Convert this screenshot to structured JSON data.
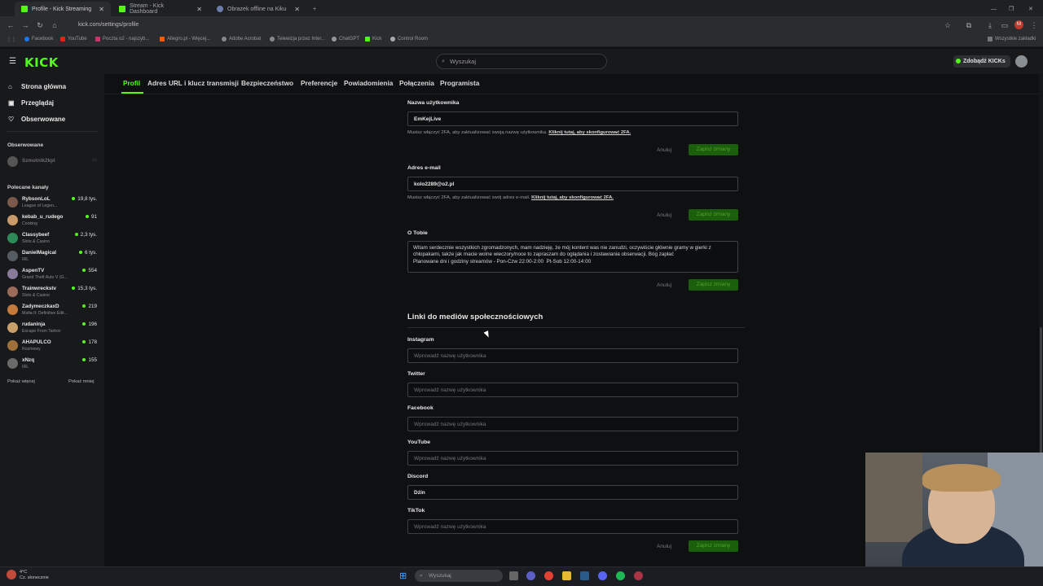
{
  "browser": {
    "tabs": [
      {
        "label": "Profile - Kick Streaming"
      },
      {
        "label": "Stream - Kick Dashboard"
      },
      {
        "label": "Obrazek offline na Kiku"
      }
    ],
    "url": "kick.com/settings/profile",
    "bookmarks": [
      "Facebook",
      "YouTube",
      "Poczta o2 - najszyb...",
      "Allegro.pl - Więcej...",
      "Adobe Acrobat",
      "Telewizja przez Inter...",
      "ChatGPT",
      "Kick",
      "Control Room"
    ],
    "bookmarks_right": "Wszystkie zakładki"
  },
  "header": {
    "logo": "KICK",
    "search_placeholder": "Wyszukaj",
    "kicks_button": "Zdobądź KICKs"
  },
  "sidebar": {
    "nav": [
      {
        "label": "Strona główna",
        "icon": "home-icon"
      },
      {
        "label": "Przeglądaj",
        "icon": "browse-icon"
      },
      {
        "label": "Obserwowane",
        "icon": "heart-icon"
      }
    ],
    "followed_title": "Obserwowane",
    "followed": [
      {
        "name": "Szmotnik2kpl"
      }
    ],
    "recommended_title": "Polecane kanały",
    "channels": [
      {
        "name": "RybsonLoL",
        "category": "League of Legen...",
        "viewers": "19,8 tys.",
        "color": "#7a5a4a"
      },
      {
        "name": "kebab_u_rudego",
        "category": "Cooking",
        "viewers": "91",
        "color": "#c99a6a"
      },
      {
        "name": "Classybeef",
        "category": "Slots & Casino",
        "viewers": "2,3 tys.",
        "color": "#2e8b57"
      },
      {
        "name": "DanielMagical",
        "category": "IRL",
        "viewers": "6 tys.",
        "color": "#555b63"
      },
      {
        "name": "AspenTV",
        "category": "Grand Theft Auto V (G...",
        "viewers": "554",
        "color": "#8a7a9a"
      },
      {
        "name": "Trainwreckstv",
        "category": "Slots & Casino",
        "viewers": "15,3 tys.",
        "color": "#9a6a5a"
      },
      {
        "name": "ZadymeczkaxD",
        "category": "Mafia II: Definitive Edit...",
        "viewers": "219",
        "color": "#c47a3a"
      },
      {
        "name": "rudaninja",
        "category": "Escape From Tarkov",
        "viewers": "196",
        "color": "#c9a06a"
      },
      {
        "name": "AHAPULCO",
        "category": "Rozmowy",
        "viewers": "178",
        "color": "#a0703a"
      },
      {
        "name": "xNzq",
        "category": "IRL",
        "viewers": "155",
        "color": "#6a6a6a"
      }
    ],
    "show_more": "Pokaż więcej",
    "show_less": "Pokaż mniej"
  },
  "settings_tabs": [
    "Profil",
    "Adres URL i klucz transmisji",
    "Bezpieczeństwo",
    "Preferencje",
    "Powiadomienia",
    "Połączenia",
    "Programista"
  ],
  "form": {
    "username_label": "Nazwa użytkownika",
    "username_value": "EmKejLive",
    "username_note": "Musisz włączyć 2FA, aby zaktualizować swoją nazwę użytkownika.",
    "twofa_link": "Kliknij tutaj, aby skonfigurować 2FA.",
    "email_label": "Adres e-mail",
    "email_value": "kolo2289@o2.pl",
    "email_note": "Musisz włączyć 2FA, aby zaktualizować swój adres e-mail.",
    "about_label": "O Tobie",
    "about_value": "Witam serdecznie wszystkich zgromadzonych, mam nadzieję, że mój kontent was nie zanudzi, oczywiście głównie gramy w gierki z chłopakami, także jak macie wolne wieczory/noce to zapraszam do oglądania i zostawiania obserwacji. Bóg zapłać\nPlanowane dni i godziny streamów - Pon-Czw 22:00-2:00  Pt-Sob 12:00-14:00",
    "cancel": "Anuluj",
    "save": "Zapisz zmiany",
    "social_title": "Linki do mediów społecznościowych",
    "social": [
      {
        "label": "Instagram",
        "value": "",
        "placeholder": "Wprowadź nazwę użytkownika"
      },
      {
        "label": "Twitter",
        "value": "",
        "placeholder": "Wprowadź nazwę użytkownika"
      },
      {
        "label": "Facebook",
        "value": "",
        "placeholder": "Wprowadź nazwę użytkownika"
      },
      {
        "label": "YouTube",
        "value": "",
        "placeholder": "Wprowadź nazwę użytkownika"
      },
      {
        "label": "Discord",
        "value": "Dżin",
        "placeholder": ""
      },
      {
        "label": "TikTok",
        "value": "",
        "placeholder": "Wprowadź nazwę użytkownika"
      }
    ]
  },
  "taskbar": {
    "temperature": "4°C",
    "weather": "Cz. słonecznie",
    "search": "Wyszukaj"
  },
  "colors": {
    "accent": "#53fc18",
    "save_button": "#1b5e0c"
  }
}
